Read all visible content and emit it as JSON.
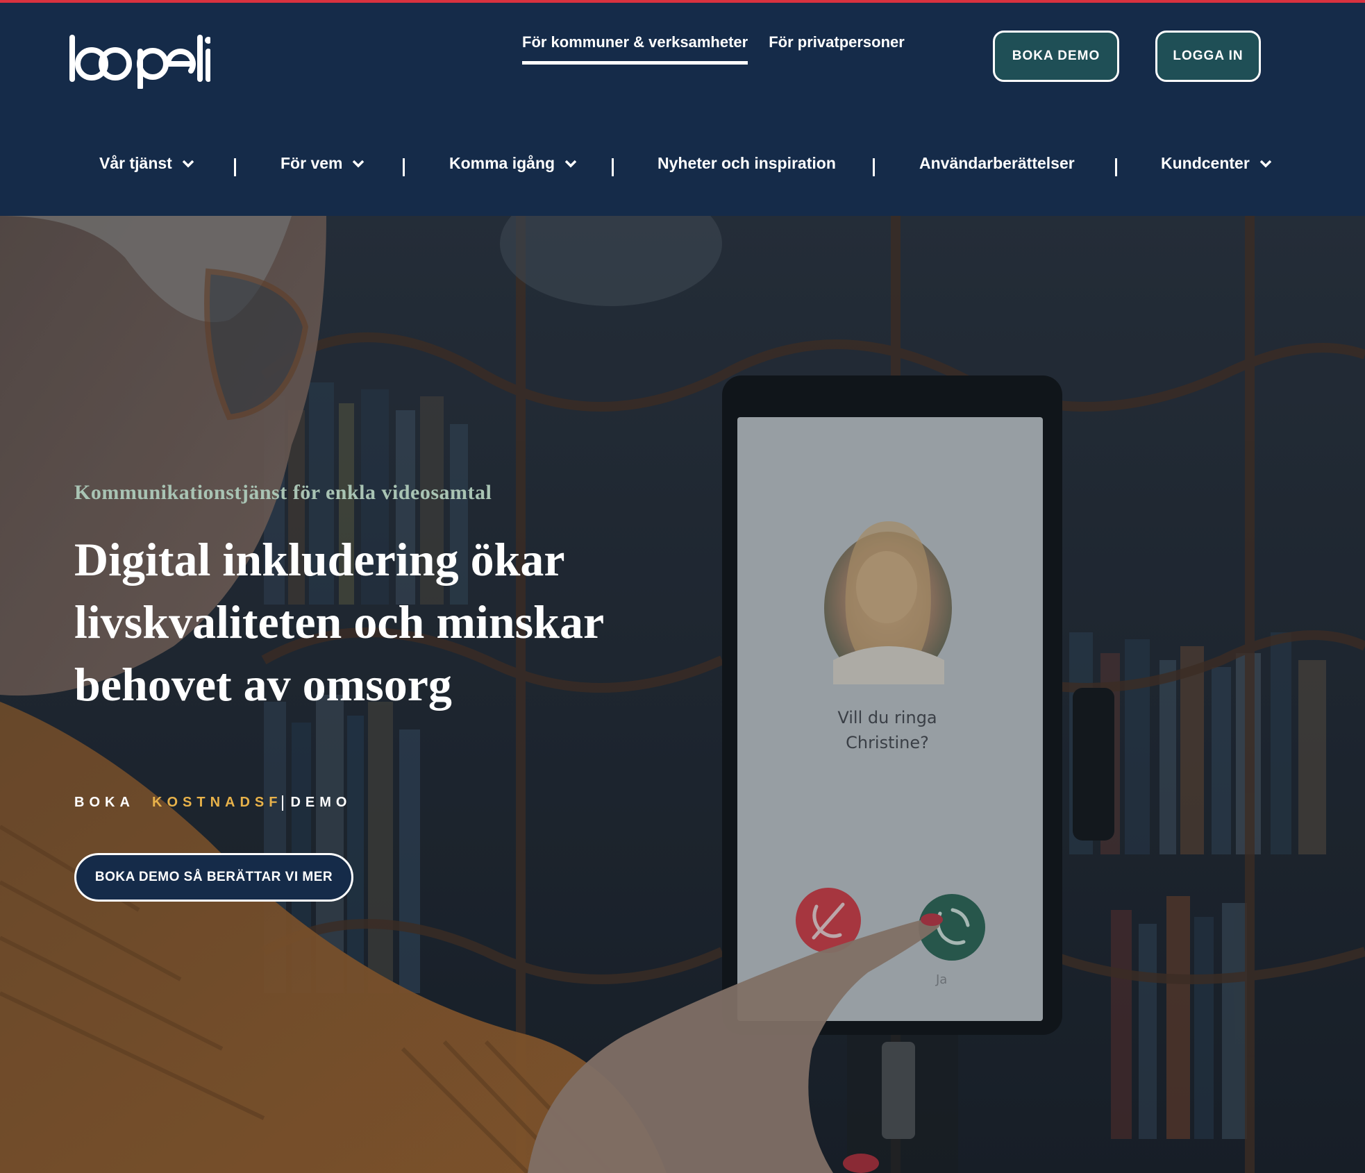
{
  "brand": {
    "logo_text": "loopeli"
  },
  "audience_tabs": [
    {
      "label": "För kommuner & verksamheter",
      "active": true
    },
    {
      "label": "För privatpersoner",
      "active": false
    }
  ],
  "header_buttons": {
    "demo": "BOKA DEMO",
    "login": "LOGGA IN"
  },
  "nav": [
    {
      "label": "Vår tjänst",
      "has_dropdown": true
    },
    {
      "label": "För vem",
      "has_dropdown": true
    },
    {
      "label": "Komma igång",
      "has_dropdown": true
    },
    {
      "label": "Nyheter och inspiration",
      "has_dropdown": false
    },
    {
      "label": "Användarberättelser",
      "has_dropdown": false
    },
    {
      "label": "Kundcenter",
      "has_dropdown": true
    }
  ],
  "hero": {
    "eyebrow": "Kommunikationstjänst för enkla videosamtal",
    "headline": "Digital inkludering ökar livskvaliteten och minskar behovet av omsorg",
    "tagline_prefix": "BOKA",
    "tagline_highlight": "KOSTNADSF",
    "tagline_suffix": "DEMO",
    "cta": "BOKA DEMO SÅ BERÄTTAR VI MER"
  },
  "tablet": {
    "prompt": "Vill du ringa Christine?",
    "accept_label": "Ja"
  },
  "colors": {
    "header_bg": "#152b49",
    "accent_line": "#d8323f",
    "eyebrow": "#a9c4b4",
    "highlight": "#e8b24a",
    "button_fill": "#1f4f56",
    "decline": "#d9404a",
    "accept": "#2f6b5a"
  }
}
